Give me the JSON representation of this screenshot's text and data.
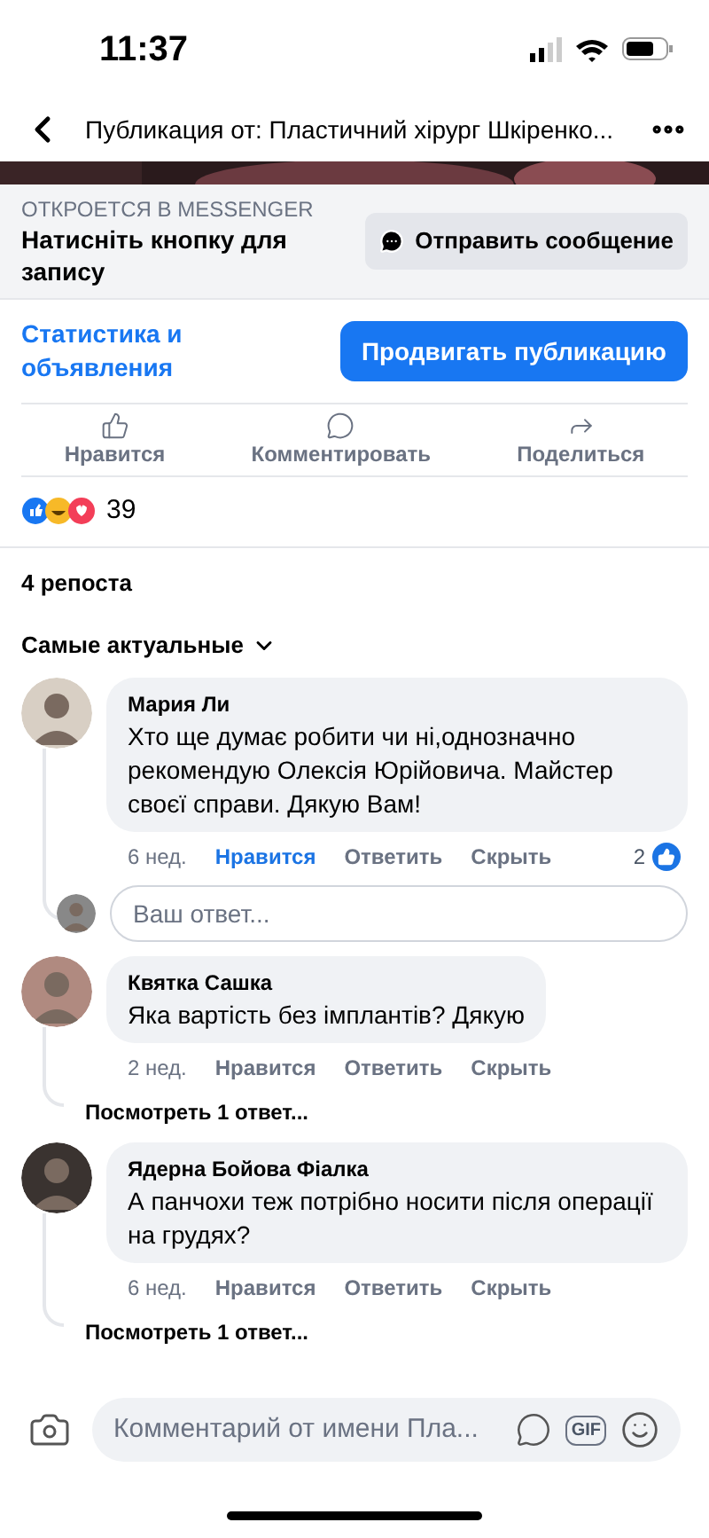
{
  "status_bar": {
    "time": "11:37"
  },
  "header": {
    "title": "Публикация от: Пластичний хірург Шкіренко..."
  },
  "messenger": {
    "caption": "ОТКРОЕТСЯ В MESSENGER",
    "text": "Натисніть кнопку для запису",
    "button": "Отправить сообщение"
  },
  "promo": {
    "link": "Статистика и объявления",
    "button": "Продвигать публикацию"
  },
  "actions": [
    {
      "kind": "like",
      "label": "Нравится"
    },
    {
      "kind": "comment",
      "label": "Комментировать"
    },
    {
      "kind": "share",
      "label": "Поделиться"
    }
  ],
  "reactions": {
    "count": "39"
  },
  "reposts": "4 репоста",
  "sort": "Самые актуальные",
  "comments": [
    {
      "author": "Мария Ли",
      "text": "Хто ще думає робити чи ні,однозначно рекомендую Олексія Юрійовича. Майстер своєї справи. Дякую Вам!",
      "time": "6 нед.",
      "like": "Нравится",
      "liked": true,
      "reply": "Ответить",
      "hide": "Скрыть",
      "likes": "2",
      "reply_field": {
        "placeholder": "Ваш ответ..."
      }
    },
    {
      "author": "Квятка Сашка",
      "text": "Яка вартість без імплантів? Дякую",
      "time": "2 нед.",
      "like": "Нравится",
      "liked": false,
      "reply": "Ответить",
      "hide": "Скрыть",
      "view_replies": "Посмотреть 1 ответ..."
    },
    {
      "author": "Ядерна Бойова Фіалка",
      "text": "А панчохи теж потрібно носити після операції на грудях?",
      "time": "6 нед.",
      "like": "Нравится",
      "liked": false,
      "reply": "Ответить",
      "hide": "Скрыть",
      "view_replies": "Посмотреть 1 ответ..."
    }
  ],
  "composer": {
    "placeholder": "Комментарий от имени Пла...",
    "gif": "GIF"
  }
}
